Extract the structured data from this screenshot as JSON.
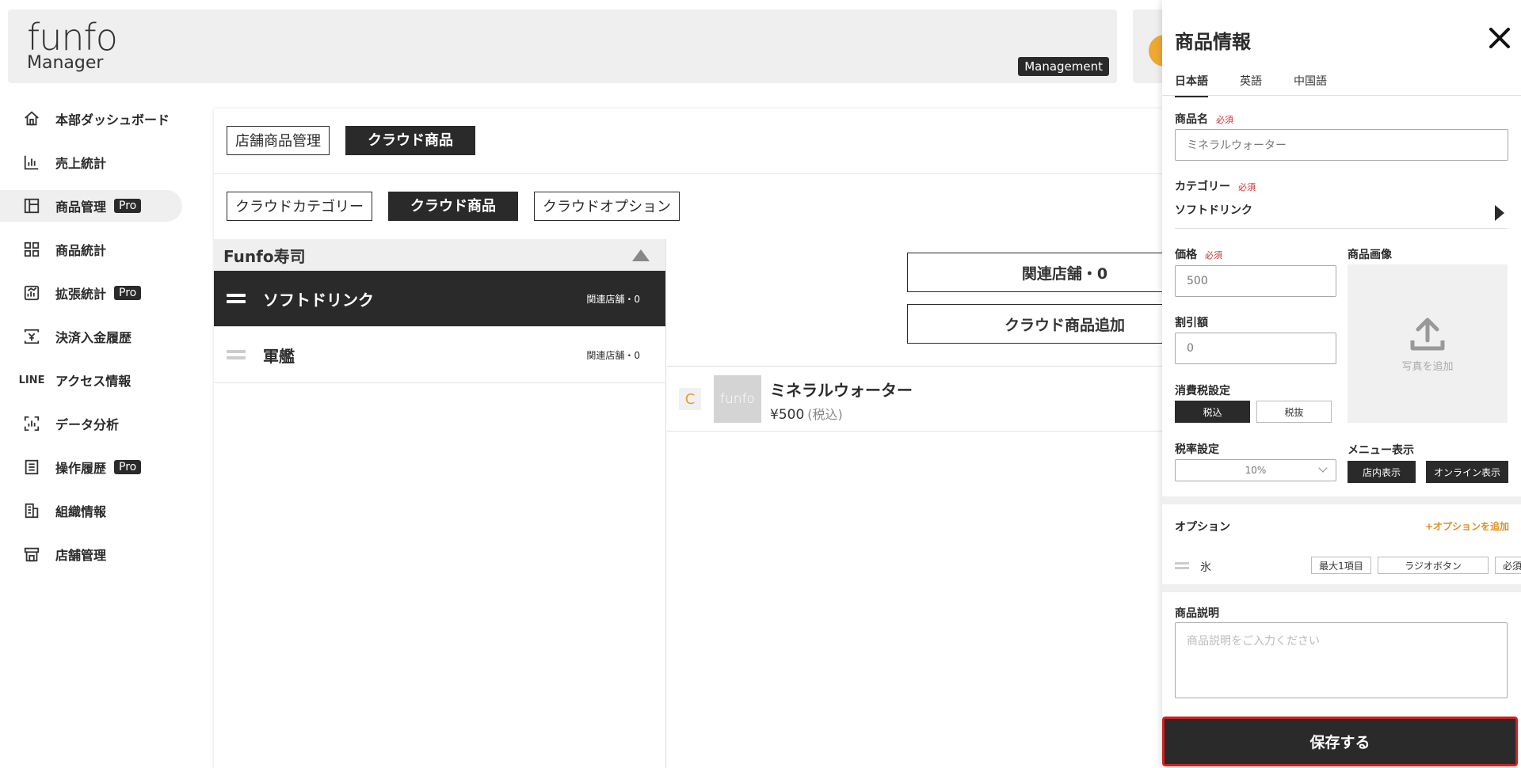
{
  "header": {
    "logo_main": "funfo",
    "logo_sub": "Manager",
    "badge": "Management"
  },
  "sidebar": {
    "items": [
      {
        "label": "本部ダッシュボード",
        "icon": "home-icon"
      },
      {
        "label": "売上統計",
        "icon": "bar-chart-icon"
      },
      {
        "label": "商品管理",
        "icon": "layout-icon",
        "pro": "Pro",
        "active": true
      },
      {
        "label": "商品統計",
        "icon": "grid-icon"
      },
      {
        "label": "拡張統計",
        "icon": "analytics-icon",
        "pro": "Pro"
      },
      {
        "label": "決済入金履歴",
        "icon": "payment-icon"
      },
      {
        "label": "アクセス情報",
        "icon": "line-icon",
        "icon_text": "LINE"
      },
      {
        "label": "データ分析",
        "icon": "scan-icon"
      },
      {
        "label": "操作履歴",
        "icon": "list-icon",
        "pro": "Pro"
      },
      {
        "label": "組織情報",
        "icon": "building-icon"
      },
      {
        "label": "店舗管理",
        "icon": "store-icon"
      }
    ]
  },
  "main": {
    "top_tabs": [
      "店舗商品管理",
      "クラウド商品"
    ],
    "sub_tabs": [
      "クラウドカテゴリー",
      "クラウド商品",
      "クラウドオプション"
    ],
    "category_header": "Funfo寿司",
    "categories": [
      {
        "name": "ソフトドリンク",
        "stores": "関連店舗・0"
      },
      {
        "name": "軍艦",
        "stores": "関連店舗・0"
      }
    ],
    "related_stores_btn": "関連店舗・0",
    "add_cloud_product_btn": "クラウド商品追加",
    "products": [
      {
        "badge": "C",
        "thumb": "funfo",
        "name": "ミネラルウォーター",
        "price": "¥500",
        "tax": "(税込)"
      }
    ]
  },
  "drawer": {
    "title": "商品情報",
    "lang_tabs": [
      "日本語",
      "英語",
      "中国語"
    ],
    "name_label": "商品名",
    "required": "必須",
    "name_value": "ミネラルウォーター",
    "category_label": "カテゴリー",
    "category_value": "ソフトドリンク",
    "price_label": "価格",
    "price_value": "500",
    "image_label": "商品画像",
    "add_photo": "写真を追加",
    "discount_label": "割引額",
    "discount_value": "0",
    "tax_label": "消費税設定",
    "tax_in": "税込",
    "tax_out": "税抜",
    "rate_label": "税率設定",
    "rate_value": "10%",
    "menu_label": "メニュー表示",
    "menu_store": "店内表示",
    "menu_online": "オンライン表示",
    "option_label": "オプション",
    "option_add": "+オプションを追加",
    "option_name": "氷",
    "option_max": "最大1項目",
    "option_type": "ラジオボタン",
    "option_req": "必須",
    "desc_label": "商品説明",
    "desc_placeholder": "商品説明をご入力ください",
    "save": "保存する"
  },
  "colors": {
    "dark": "#2a2a2a",
    "required": "#d03030",
    "accent_orange": "#e09020",
    "save_border": "#d02020"
  }
}
